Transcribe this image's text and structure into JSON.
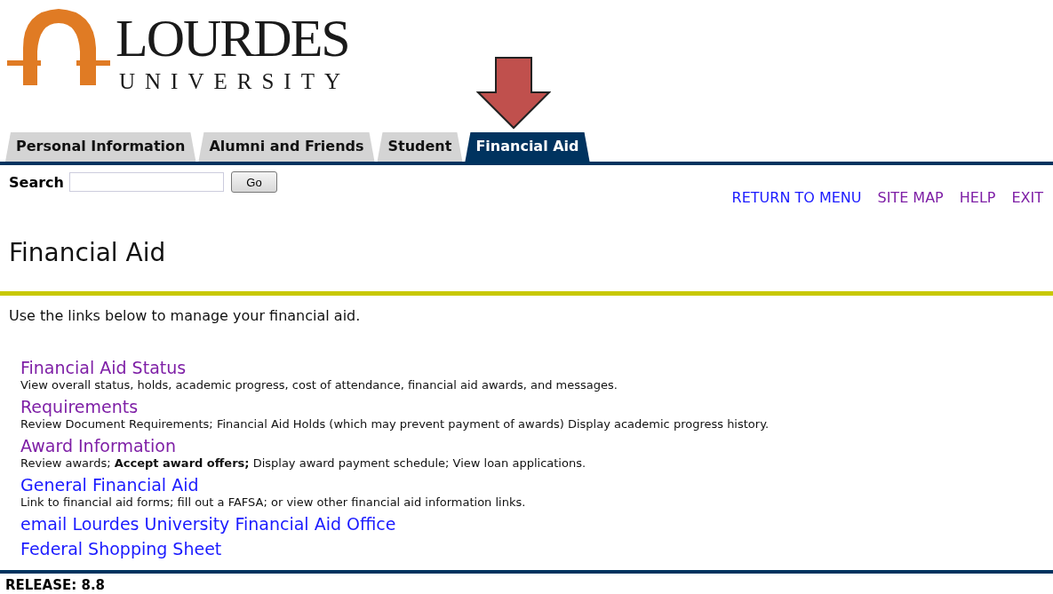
{
  "logo": {
    "name": "LOURDES",
    "subtitle": "UNIVERSITY"
  },
  "tabs": [
    {
      "label": "Personal Information",
      "selected": false
    },
    {
      "label": "Alumni and Friends",
      "selected": false
    },
    {
      "label": "Student",
      "selected": false
    },
    {
      "label": "Financial Aid",
      "selected": true
    }
  ],
  "search": {
    "label": "Search",
    "button": "Go"
  },
  "top_links": [
    {
      "label": "RETURN TO MENU",
      "visited": false
    },
    {
      "label": "SITE MAP",
      "visited": true
    },
    {
      "label": "HELP",
      "visited": true
    },
    {
      "label": "EXIT",
      "visited": true
    }
  ],
  "page_title": "Financial Aid",
  "intro": "Use the links below to manage your financial aid.",
  "menu_items": [
    {
      "title": "Financial Aid Status",
      "visited": true,
      "description": "View overall status, holds, academic progress, cost of attendance, financial aid awards, and messages."
    },
    {
      "title": "Requirements",
      "visited": true,
      "description": "Review Document Requirements; Financial Aid Holds (which may prevent payment of awards) Display academic progress history."
    },
    {
      "title": "Award Information",
      "visited": true,
      "description": "Review awards; **Accept award offers;** Display award payment schedule; View loan applications."
    },
    {
      "title": "General Financial Aid",
      "visited": false,
      "description": "Link to financial aid forms; fill out a FAFSA; or view other financial aid information links."
    },
    {
      "title": "email Lourdes University Financial Aid Office",
      "visited": false
    },
    {
      "title": "Federal Shopping Sheet",
      "visited": false
    }
  ],
  "release": "RELEASE: 8.8"
}
